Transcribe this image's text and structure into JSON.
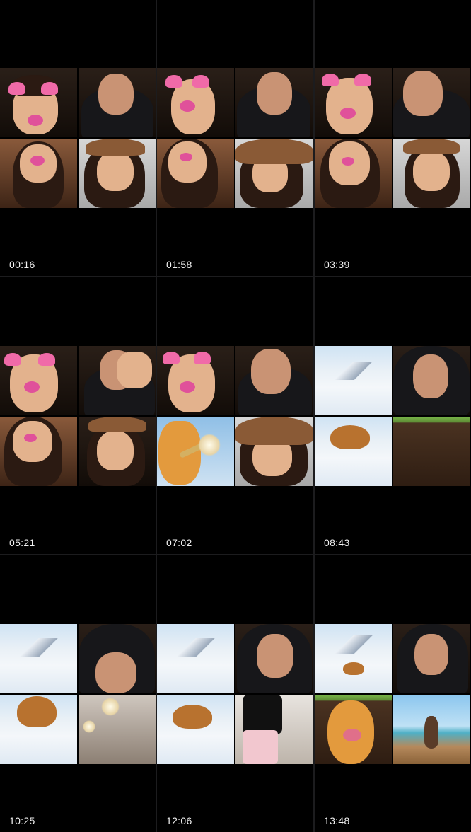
{
  "timestamps": [
    "00:16",
    "01:58",
    "03:39",
    "05:21",
    "07:02",
    "08:43",
    "10:25",
    "12:06",
    "13:48"
  ],
  "colors": {
    "background": "#000000",
    "separator": "#1c1c1e",
    "timestamp_text": "#f2f2f2",
    "filter_pink": "#f06aa8"
  },
  "frames": [
    {
      "tiles": [
        "dog-filter-face",
        "hooded-face",
        "dog-filter-face",
        "bear-hat-face"
      ]
    },
    {
      "tiles": [
        "dog-filter-face",
        "hooded-face",
        "dog-filter-face",
        "bear-hat-face"
      ]
    },
    {
      "tiles": [
        "dog-filter-face",
        "hooded-face",
        "dog-filter-face",
        "bear-hat-face"
      ]
    },
    {
      "tiles": [
        "dog-filter-face",
        "hooded-face",
        "dog-filter-face",
        "bear-hat-face"
      ]
    },
    {
      "tiles": [
        "dog-filter-face",
        "hooded-face",
        "cartoon-trombone",
        "bear-hat-face"
      ]
    },
    {
      "tiles": [
        "snow-beaver",
        "hooded-face",
        "snow-beaver",
        "soil-scene"
      ]
    },
    {
      "tiles": [
        "snow-beaver",
        "hooded-face",
        "snow-beaver",
        "ceiling-light"
      ]
    },
    {
      "tiles": [
        "snow-beaver",
        "hooded-face",
        "snow-beaver",
        "mirror-selfie"
      ]
    },
    {
      "tiles": [
        "snow-beaver",
        "hooded-face",
        "cartoon-face",
        "pier-cat"
      ]
    }
  ]
}
